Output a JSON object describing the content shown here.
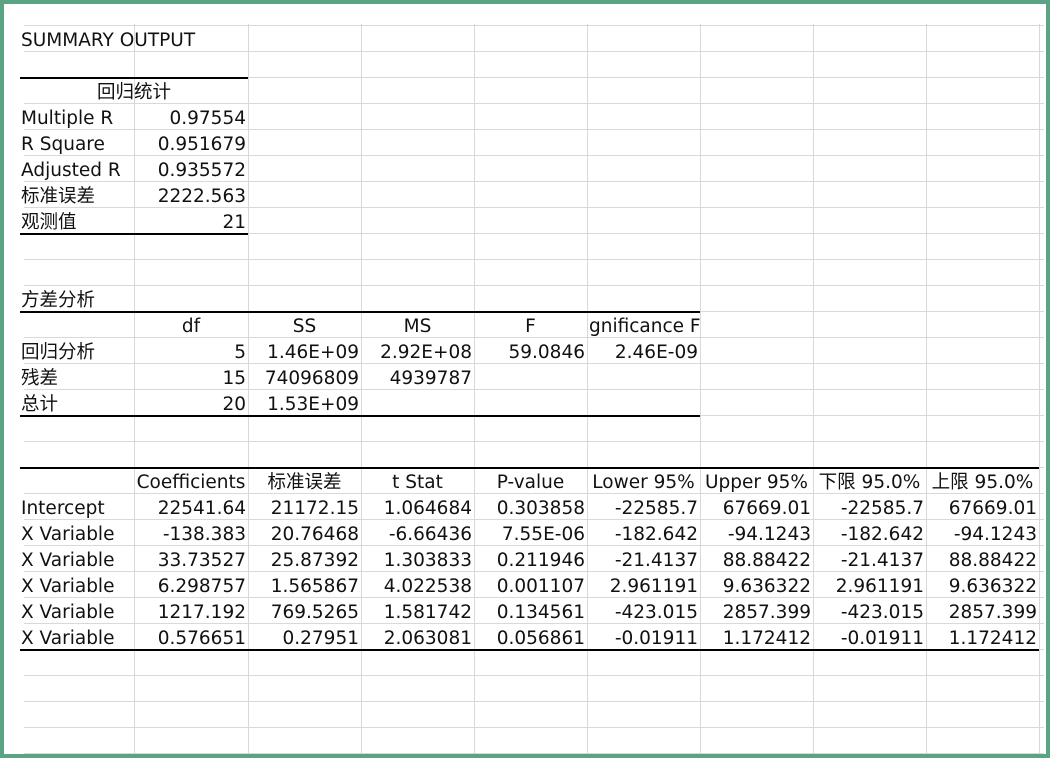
{
  "summary_title": "SUMMARY OUTPUT",
  "regression_stats": {
    "title": "回归统计",
    "rows": [
      {
        "label": "Multiple R",
        "value": "0.97554"
      },
      {
        "label": "R Square",
        "value": "0.951679"
      },
      {
        "label": "Adjusted R",
        "value": "0.935572"
      },
      {
        "label": "标准误差",
        "value": "2222.563"
      },
      {
        "label": "观测值",
        "value": "21"
      }
    ]
  },
  "anova": {
    "title": "方差分析",
    "headers": [
      "",
      "df",
      "SS",
      "MS",
      "F",
      "gnificance F"
    ],
    "rows": [
      [
        "回归分析",
        "5",
        "1.46E+09",
        "2.92E+08",
        "59.0846",
        "2.46E-09"
      ],
      [
        "残差",
        "15",
        "74096809",
        "4939787",
        "",
        ""
      ],
      [
        "总计",
        "20",
        "1.53E+09",
        "",
        "",
        ""
      ]
    ]
  },
  "coefficients": {
    "headers": [
      "",
      "Coefficients",
      "标准误差",
      "t Stat",
      "P-value",
      "Lower 95%",
      "Upper 95%",
      "下限 95.0%",
      "上限 95.0%"
    ],
    "rows": [
      [
        "Intercept",
        "22541.64",
        "21172.15",
        "1.064684",
        "0.303858",
        "-22585.7",
        "67669.01",
        "-22585.7",
        "67669.01"
      ],
      [
        "X Variable",
        "-138.383",
        "20.76468",
        "-6.66436",
        "7.55E-06",
        "-182.642",
        "-94.1243",
        "-182.642",
        "-94.1243"
      ],
      [
        "X Variable",
        "33.73527",
        "25.87392",
        "1.303833",
        "0.211946",
        "-21.4137",
        "88.88422",
        "-21.4137",
        "88.88422"
      ],
      [
        "X Variable",
        "6.298757",
        "1.565867",
        "4.022538",
        "0.001107",
        "2.961191",
        "9.636322",
        "2.961191",
        "9.636322"
      ],
      [
        "X Variable",
        "1217.192",
        "769.5265",
        "1.581742",
        "0.134561",
        "-423.015",
        "2857.399",
        "-423.015",
        "2857.399"
      ],
      [
        "X Variable",
        "0.576651",
        "0.27951",
        "2.063081",
        "0.056861",
        "-0.01911",
        "1.172412",
        "-0.01911",
        "1.172412"
      ]
    ]
  }
}
